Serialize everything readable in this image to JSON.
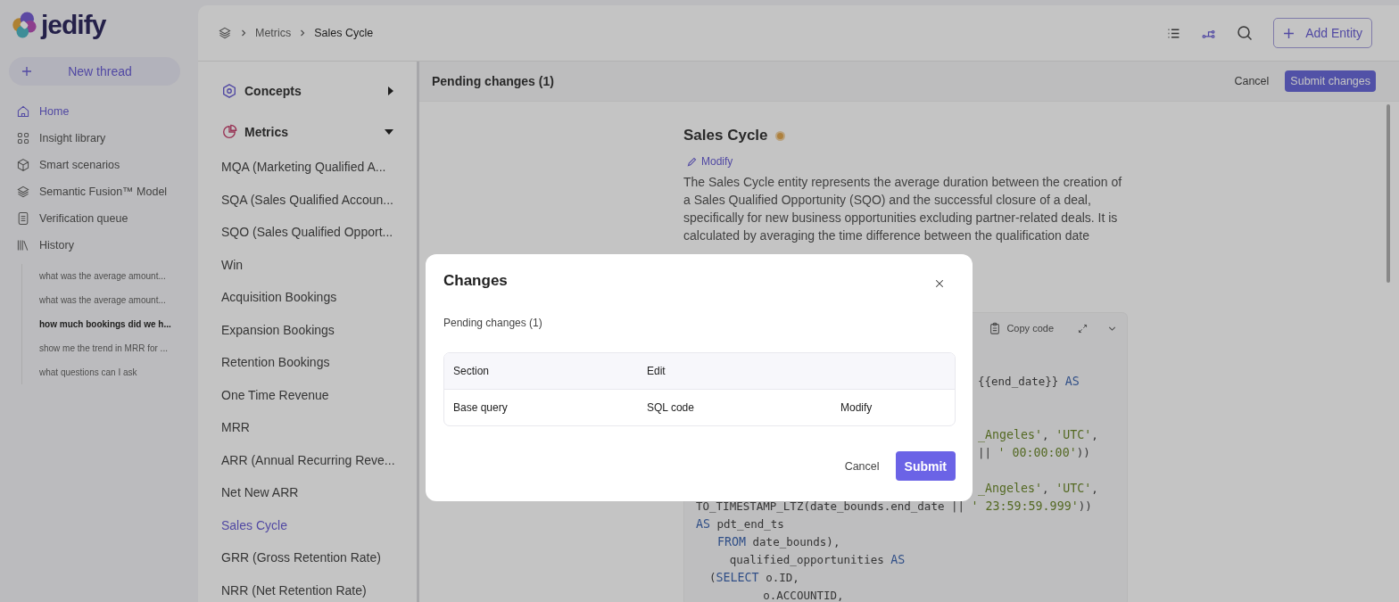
{
  "sidebar": {
    "brand": "jedify",
    "new_thread": "New thread",
    "nav": [
      {
        "label": "Home",
        "selected": true
      },
      {
        "label": "Insight library",
        "selected": false
      },
      {
        "label": "Smart scenarios",
        "selected": false
      },
      {
        "label": "Semantic Fusion™ Model",
        "selected": false
      },
      {
        "label": "Verification queue",
        "selected": false
      },
      {
        "label": "History",
        "selected": false
      }
    ],
    "history": [
      {
        "label": "what was the average amount...",
        "selected": false
      },
      {
        "label": "what was the average amount...",
        "selected": false
      },
      {
        "label": "how much bookings did we h...",
        "selected": true
      },
      {
        "label": "show me the trend in MRR for ...",
        "selected": false
      },
      {
        "label": "what questions can I ask",
        "selected": false
      }
    ]
  },
  "breadcrumb": [
    "Metrics",
    "Sales Cycle"
  ],
  "toolbar": {
    "add_entity": "Add Entity"
  },
  "entity_nav": {
    "sections": [
      {
        "label": "Concepts",
        "expanded": false
      },
      {
        "label": "Metrics",
        "expanded": true
      }
    ],
    "items": [
      {
        "label": "MQA (Marketing Qualified A...",
        "selected": false
      },
      {
        "label": "SQA (Sales Qualified Accoun...",
        "selected": false
      },
      {
        "label": "SQO (Sales Qualified Opport...",
        "selected": false
      },
      {
        "label": "Win",
        "selected": false
      },
      {
        "label": "Acquisition Bookings",
        "selected": false
      },
      {
        "label": "Expansion Bookings",
        "selected": false
      },
      {
        "label": "Retention Bookings",
        "selected": false
      },
      {
        "label": "One Time Revenue",
        "selected": false
      },
      {
        "label": "MRR",
        "selected": false
      },
      {
        "label": "ARR (Annual Recurring Reve...",
        "selected": false
      },
      {
        "label": "Net New ARR",
        "selected": false
      },
      {
        "label": "Sales Cycle",
        "selected": true
      },
      {
        "label": "GRR (Gross Retention Rate)",
        "selected": false
      },
      {
        "label": "NRR (Net Retention Rate)",
        "selected": false
      }
    ]
  },
  "pending_bar": {
    "title": "Pending changes (1)",
    "cancel": "Cancel",
    "submit": "Submit changes"
  },
  "entity": {
    "title": "Sales Cycle",
    "modify": "Modify",
    "description": "The Sales Cycle entity represents the average duration between the creation of a Sales Qualified Opportunity (SQO) and the successful closure of a deal, specifically for new business opportunities excluding partner-related deals. It is calculated by averaging the time difference between the qualification date",
    "copy_code": "Copy code",
    "code_lines": [
      {
        "kind": "partial",
        "tokens": [
          {
            "kind": "plain",
            "text": "{{end_date}} "
          },
          {
            "kind": "kw",
            "text": "AS"
          }
        ]
      },
      {
        "kind": "blank"
      },
      {
        "kind": "blank"
      },
      {
        "kind": "partial",
        "tokens": [
          {
            "kind": "str",
            "text": "_Angeles'"
          },
          {
            "kind": "plain",
            "text": ", "
          },
          {
            "kind": "str",
            "text": "'UTC'"
          },
          {
            "kind": "plain",
            "text": ","
          }
        ]
      },
      {
        "kind": "partial",
        "tokens": [
          {
            "kind": "plain",
            "text": "|| "
          },
          {
            "kind": "str",
            "text": "' 00:00:00'"
          },
          {
            "kind": "plain",
            "text": "))"
          }
        ]
      },
      {
        "kind": "blank"
      },
      {
        "kind": "partial",
        "tokens": [
          {
            "kind": "str",
            "text": "_Angeles'"
          },
          {
            "kind": "plain",
            "text": ", "
          },
          {
            "kind": "str",
            "text": "'UTC'"
          },
          {
            "kind": "plain",
            "text": ","
          }
        ]
      },
      {
        "kind": "full",
        "tokens": [
          {
            "kind": "plain",
            "text": "TO_TIMESTAMP_LTZ(date_bounds.end_date || "
          },
          {
            "kind": "str",
            "text": "' 23:59:59.999'"
          },
          {
            "kind": "plain",
            "text": "))"
          }
        ]
      },
      {
        "kind": "full",
        "tokens": [
          {
            "kind": "kw",
            "text": "AS"
          },
          {
            "kind": "plain",
            "text": " pdt_end_ts"
          }
        ]
      },
      {
        "kind": "full",
        "tokens": [
          {
            "kind": "kw",
            "text": "   FROM"
          },
          {
            "kind": "plain",
            "text": " date_bounds),"
          }
        ]
      },
      {
        "kind": "full",
        "tokens": [
          {
            "kind": "plain",
            "text": "     qualified_opportunities "
          },
          {
            "kind": "kw",
            "text": "AS"
          }
        ]
      },
      {
        "kind": "full",
        "tokens": [
          {
            "kind": "plain",
            "text": "  ("
          },
          {
            "kind": "kw",
            "text": "SELECT"
          },
          {
            "kind": "plain",
            "text": " o.ID,"
          }
        ]
      },
      {
        "kind": "full",
        "tokens": [
          {
            "kind": "plain",
            "text": "          o.ACCOUNTID,"
          }
        ]
      }
    ]
  },
  "dialog": {
    "title": "Changes",
    "subtitle": "Pending changes (1)",
    "columns": [
      "Section",
      "Edit"
    ],
    "rows": [
      [
        "Base query",
        "SQL code",
        "Modify"
      ]
    ],
    "cancel": "Cancel",
    "submit": "Submit"
  }
}
